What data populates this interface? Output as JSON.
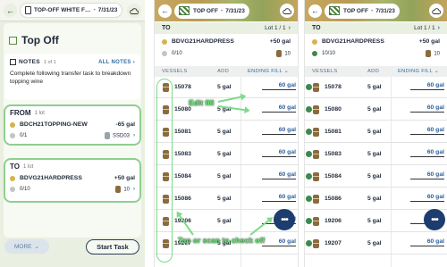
{
  "panel1": {
    "header": {
      "title": "TOP-OFF WHITE F…",
      "date": "7/31/23"
    },
    "task_title": "Top Off",
    "notes": {
      "label": "NOTES",
      "count": "1 of 1",
      "all_link": "ALL NOTES",
      "text": "Complete following transfer task to breakdown topping wine"
    },
    "from": {
      "label": "FROM",
      "lots": "1 lot",
      "lot_name": "BDCH21TOPPING-NEW",
      "amount": "-65 gal",
      "progress": "0/1",
      "vessel": "SSD03"
    },
    "to": {
      "label": "TO",
      "lots": "1 lot",
      "lot_name": "BDVG21HARDPRESS",
      "amount": "+50 gal",
      "progress": "0/10",
      "count": "10"
    },
    "more_label": "MORE",
    "start_label": "Start Task"
  },
  "panel2": {
    "header": {
      "title": "TOP OFF",
      "date": "7/31/23"
    },
    "to_label": "TO",
    "lot_count": "Lot 1 / 1",
    "lot_name": "BDVG21HARDPRESS",
    "amount": "+50 gal",
    "progress": "0/10",
    "count": "10",
    "columns": [
      "VESSELS",
      "ADD",
      "ENDING FILL"
    ],
    "rows": [
      {
        "vessel": "15078",
        "add": "5 gal",
        "fill": "60 gal"
      },
      {
        "vessel": "15080",
        "add": "5 gal",
        "fill": "60 gal"
      },
      {
        "vessel": "15081",
        "add": "5 gal",
        "fill": "60 gal"
      },
      {
        "vessel": "15083",
        "add": "5 gal",
        "fill": "60 gal"
      },
      {
        "vessel": "15084",
        "add": "5 gal",
        "fill": "60 gal"
      },
      {
        "vessel": "15086",
        "add": "5 gal",
        "fill": "60 gal"
      },
      {
        "vessel": "19206",
        "add": "5 gal",
        "fill": "60 gal"
      },
      {
        "vessel": "19207",
        "add": "5 gal",
        "fill": "60 gal"
      }
    ]
  },
  "panel3": {
    "header": {
      "title": "TOP OFF",
      "date": "7/31/23"
    },
    "to_label": "TO",
    "lot_count": "Lot 1 / 1",
    "lot_name": "BDVG21HARDPRESS",
    "amount": "+50 gal",
    "progress": "10/10",
    "count": "10",
    "columns": [
      "VESSELS",
      "ADD",
      "ENDING FILL"
    ],
    "rows": [
      {
        "vessel": "15078",
        "add": "5 gal",
        "fill": "60 gal"
      },
      {
        "vessel": "15080",
        "add": "5 gal",
        "fill": "60 gal"
      },
      {
        "vessel": "15081",
        "add": "5 gal",
        "fill": "60 gal"
      },
      {
        "vessel": "15083",
        "add": "5 gal",
        "fill": "60 gal"
      },
      {
        "vessel": "15084",
        "add": "5 gal",
        "fill": "60 gal"
      },
      {
        "vessel": "15086",
        "add": "5 gal",
        "fill": "60 gal"
      },
      {
        "vessel": "19206",
        "add": "5 gal",
        "fill": "60 gal"
      },
      {
        "vessel": "19207",
        "add": "5 gal",
        "fill": "60 gal"
      }
    ]
  },
  "annotations": {
    "edit_fill": "Edit fill",
    "tap_scan": "Tap or scan to check off"
  },
  "fab_label": "•••",
  "colors": {
    "accent": "#2f6ea5",
    "highlight": "#7ed98a",
    "fab": "#1c3d6e",
    "barrel": "#8a6b3f"
  }
}
